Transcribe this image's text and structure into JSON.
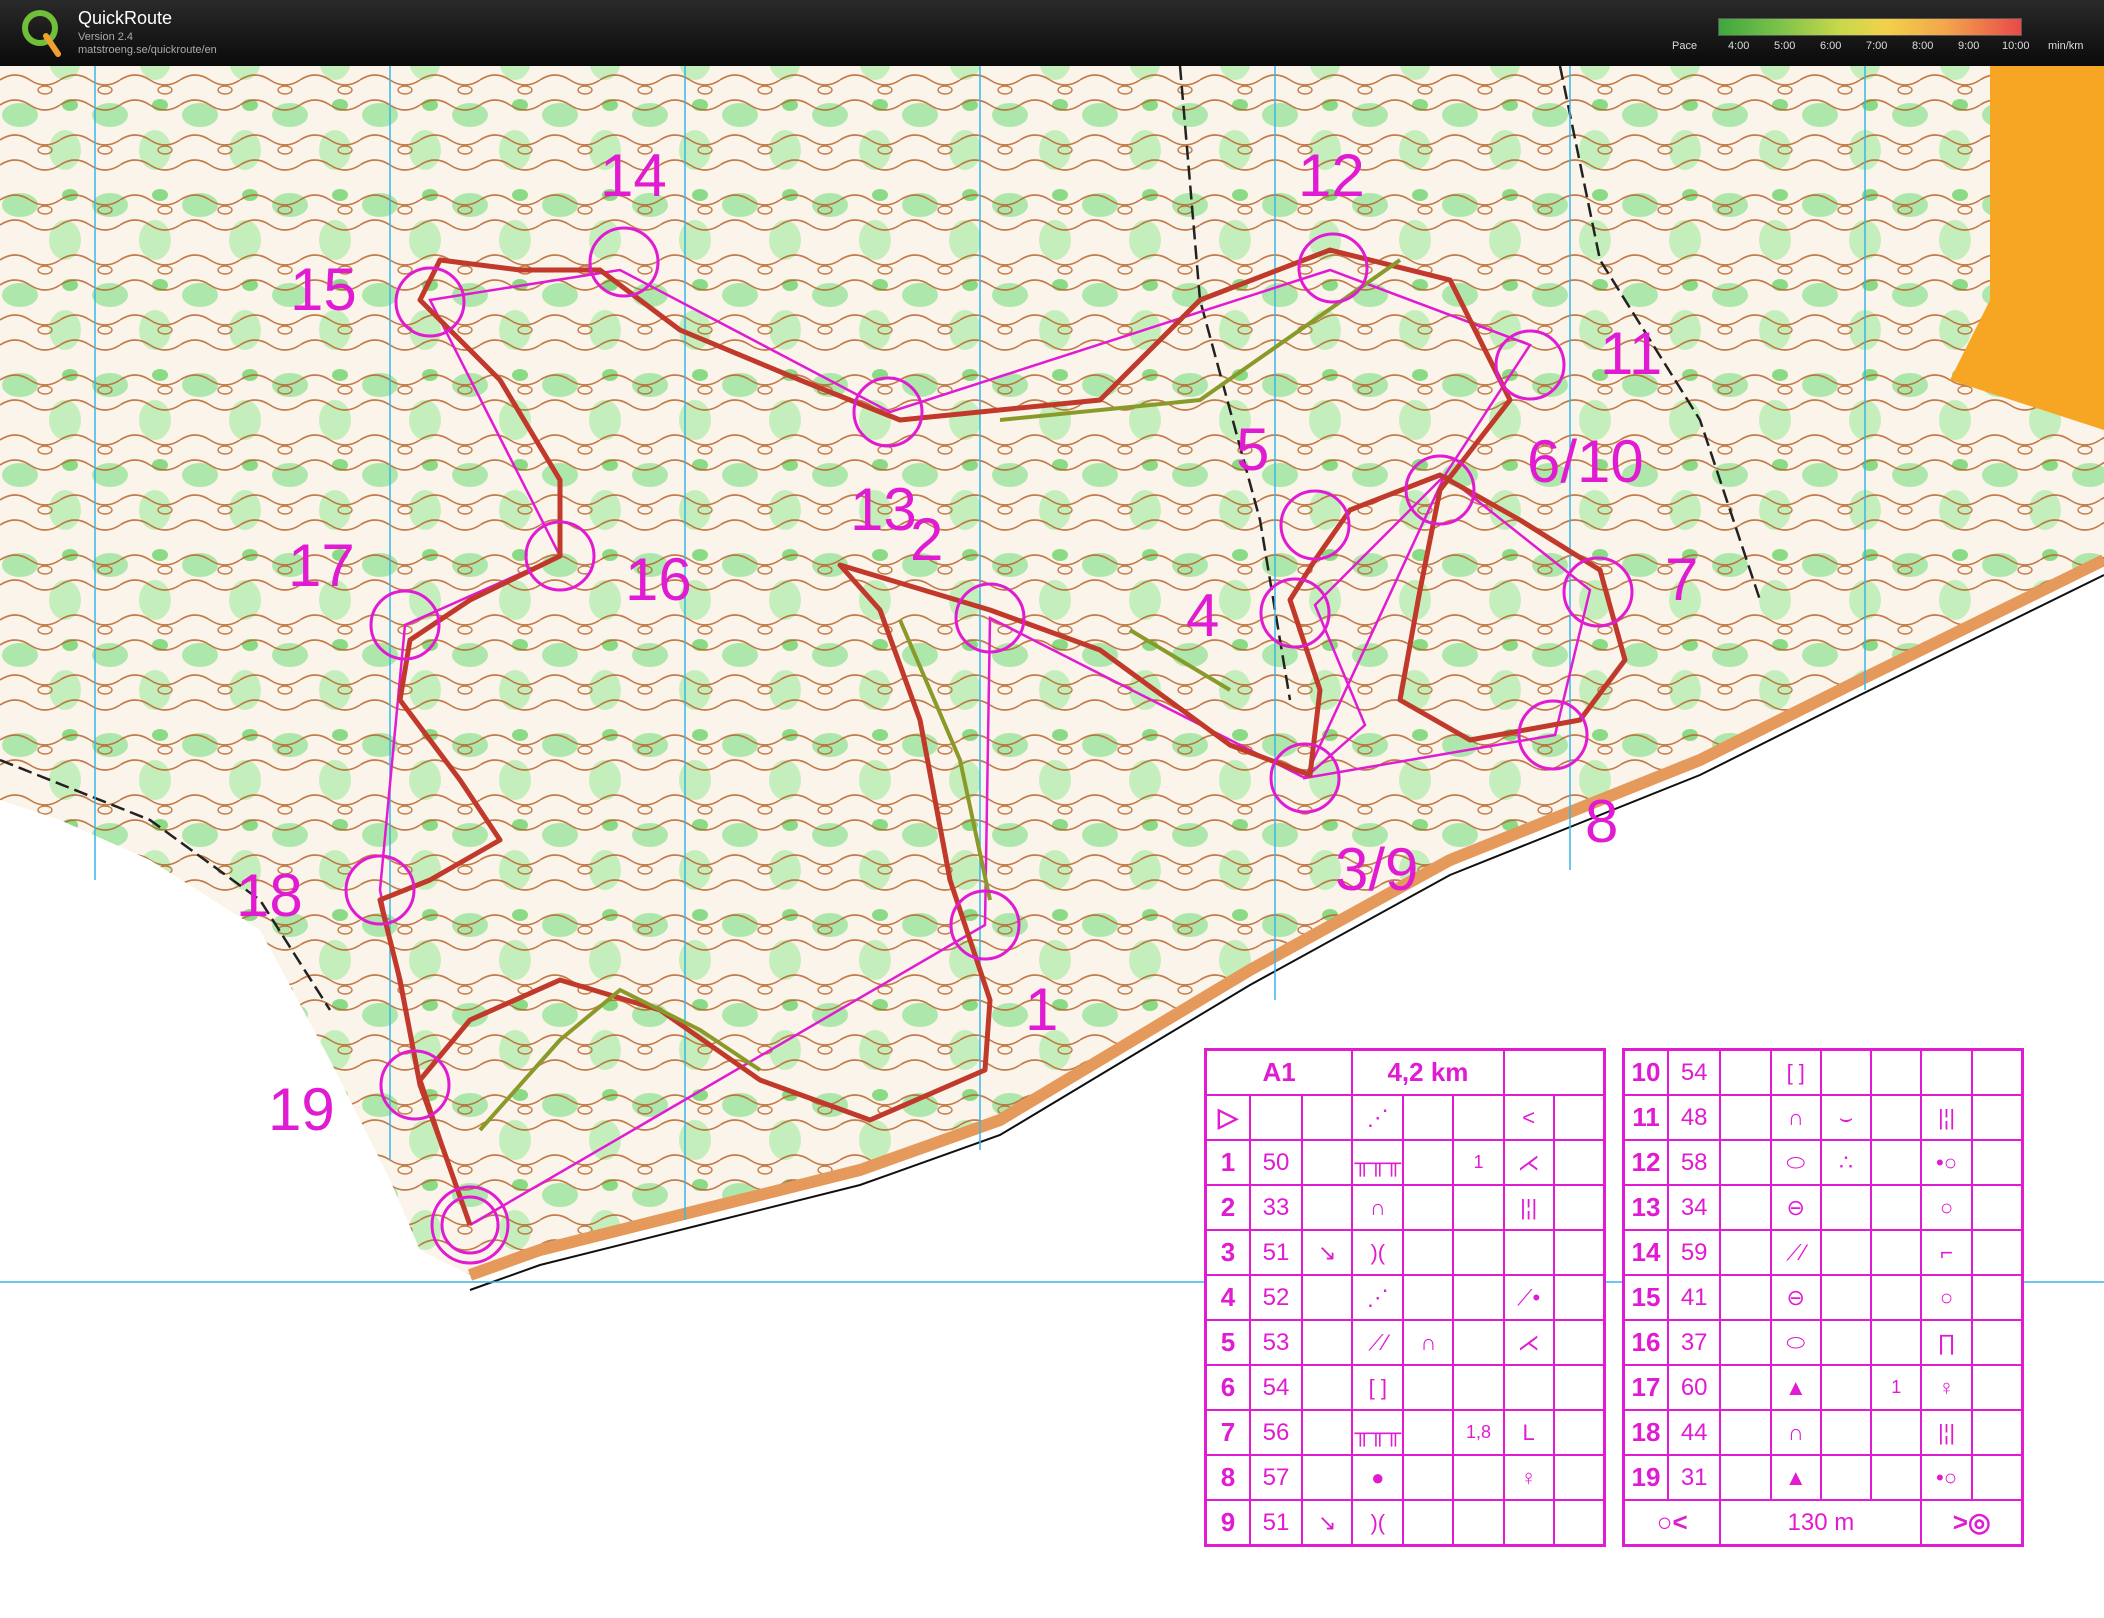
{
  "app": {
    "title": "QuickRoute",
    "version": "Version 2.4",
    "url": "matstroeng.se/quickroute/en"
  },
  "pace_legend": {
    "label": "Pace",
    "ticks": [
      "4:00",
      "5:00",
      "6:00",
      "7:00",
      "8:00",
      "9:00",
      "10:00"
    ],
    "unit": "min/km",
    "colors": [
      "#3fa63f",
      "#7cc24a",
      "#c8d84a",
      "#f1d24a",
      "#f3a64a",
      "#e84a4a"
    ]
  },
  "map": {
    "accent_color": "#e01bd2",
    "route_colors": [
      "#c0392b",
      "#e8a33d",
      "#6b8e23"
    ],
    "control_labels": [
      "14",
      "12",
      "15",
      "11",
      "5",
      "6/10",
      "13",
      "2",
      "17",
      "16",
      "7",
      "4",
      "3/9",
      "8",
      "18",
      "1",
      "19"
    ]
  },
  "control_descriptions": {
    "header": {
      "class": "A1",
      "length": "4,2 km"
    },
    "rows": [
      {
        "n": "1",
        "code": "50",
        "d": "",
        "e": "╥╥╥",
        "f": "",
        "g": "1",
        "h": "⋌"
      },
      {
        "n": "2",
        "code": "33",
        "d": "",
        "e": "∩",
        "f": "",
        "g": "",
        "h": "|¦|"
      },
      {
        "n": "3",
        "code": "51",
        "d": "↘",
        "e": ")(",
        "f": "",
        "g": "",
        "h": ""
      },
      {
        "n": "4",
        "code": "52",
        "d": "",
        "e": "⋰",
        "f": "",
        "g": "",
        "h": "⟋•"
      },
      {
        "n": "5",
        "code": "53",
        "d": "",
        "e": "⟋⁄",
        "f": "∩",
        "g": "",
        "h": "⋌"
      },
      {
        "n": "6",
        "code": "54",
        "d": "",
        "e": "[ ]",
        "f": "",
        "g": "",
        "h": ""
      },
      {
        "n": "7",
        "code": "56",
        "d": "",
        "e": "╥╥╥",
        "f": "",
        "g": "1,8",
        "h": "L"
      },
      {
        "n": "8",
        "code": "57",
        "d": "",
        "e": "●",
        "f": "",
        "g": "",
        "h": "♀"
      },
      {
        "n": "9",
        "code": "51",
        "d": "↘",
        "e": ")(",
        "f": "",
        "g": "",
        "h": ""
      },
      {
        "n": "10",
        "code": "54",
        "d": "",
        "e": "[ ]",
        "f": "",
        "g": "",
        "h": ""
      },
      {
        "n": "11",
        "code": "48",
        "d": "",
        "e": "∩",
        "f": "⌣",
        "g": "",
        "h": "|¦|"
      },
      {
        "n": "12",
        "code": "58",
        "d": "",
        "e": "⬭",
        "f": "∴",
        "g": "",
        "h": "•○"
      },
      {
        "n": "13",
        "code": "34",
        "d": "",
        "e": "⊖",
        "f": "",
        "g": "",
        "h": "○"
      },
      {
        "n": "14",
        "code": "59",
        "d": "",
        "e": "⟋⁄",
        "f": "",
        "g": "",
        "h": "⌐"
      },
      {
        "n": "15",
        "code": "41",
        "d": "",
        "e": "⊖",
        "f": "",
        "g": "",
        "h": "○"
      },
      {
        "n": "16",
        "code": "37",
        "d": "",
        "e": "⬭",
        "f": "",
        "g": "",
        "h": "∏"
      },
      {
        "n": "17",
        "code": "60",
        "d": "",
        "e": "▲",
        "f": "",
        "g": "1",
        "h": "♀"
      },
      {
        "n": "18",
        "code": "44",
        "d": "",
        "e": "∩",
        "f": "",
        "g": "",
        "h": "|¦|"
      },
      {
        "n": "19",
        "code": "31",
        "d": "",
        "e": "▲",
        "f": "",
        "g": "",
        "h": "•○"
      }
    ],
    "finish": {
      "distance": "130 m"
    }
  }
}
